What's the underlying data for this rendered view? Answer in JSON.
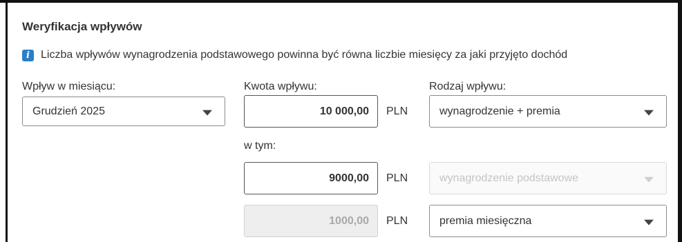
{
  "section": {
    "title": "Weryfikacja wpływów",
    "info": "Liczba wpływów wynagrodzenia podstawowego powinna być równa liczbie miesięcy za jaki przyjęto dochód"
  },
  "labels": {
    "month": "Wpływ w miesiącu:",
    "amount": "Kwota wpływu:",
    "type": "Rodzaj wpływu:",
    "including": "w tym:"
  },
  "month_select": {
    "value": "Grudzień 2025"
  },
  "rows": [
    {
      "amount": "10 000,00",
      "currency": "PLN",
      "type": "wynagrodzenie + premia",
      "amount_enabled": true,
      "type_enabled": true
    },
    {
      "amount": "9000,00",
      "currency": "PLN",
      "type": "wynagrodzenie podstawowe",
      "amount_enabled": true,
      "type_enabled": false
    },
    {
      "amount": "1000,00",
      "currency": "PLN",
      "type": "premia miesięczna",
      "amount_enabled": false,
      "type_enabled": true
    }
  ],
  "icons": {
    "info": "info-icon",
    "caret": "chevron-down-icon"
  },
  "colors": {
    "info_icon_bg": "#2a7ec6"
  }
}
